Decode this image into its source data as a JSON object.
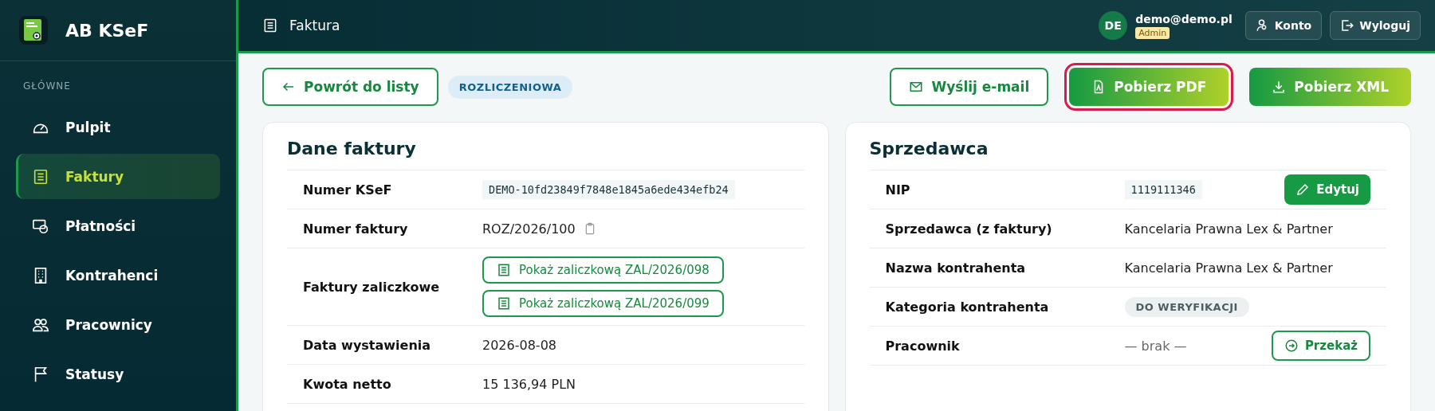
{
  "brand": {
    "name": "AB KSeF"
  },
  "sidebar": {
    "section_label": "GŁÓWNE",
    "items": [
      {
        "label": "Pulpit",
        "selected": false
      },
      {
        "label": "Faktury",
        "selected": true
      },
      {
        "label": "Płatności",
        "selected": false
      },
      {
        "label": "Kontrahenci",
        "selected": false
      },
      {
        "label": "Pracownicy",
        "selected": false
      },
      {
        "label": "Statusy",
        "selected": false
      }
    ]
  },
  "header": {
    "title": "Faktura",
    "user": {
      "initials": "DE",
      "email": "demo@demo.pl",
      "role": "Admin"
    },
    "buttons": [
      "Konto",
      "Wyloguj"
    ]
  },
  "toolbar": {
    "back_button": "Powrót do listy",
    "type_badge": "ROZLICZENIOWA",
    "actions": [
      {
        "label": "Wyślij e-mail",
        "kind": "outline",
        "focused": false
      },
      {
        "label": "Pobierz PDF",
        "kind": "solid",
        "focused": true
      },
      {
        "label": "Pobierz XML",
        "kind": "solid",
        "focused": false
      }
    ]
  },
  "invoice_card": {
    "title": "Dane faktury",
    "rows": [
      {
        "label": "Numer KSeF",
        "kind": "code",
        "value": "DEMO-10fd23849f7848e1845a6ede434efb24"
      },
      {
        "label": "Numer faktury",
        "kind": "copy",
        "value": "ROZ/2026/100"
      },
      {
        "label": "Faktury zaliczkowe",
        "kind": "links",
        "links": [
          "Pokaż zaliczkową ZAL/2026/098",
          "Pokaż zaliczkową ZAL/2026/099"
        ]
      },
      {
        "label": "Data wystawienia",
        "kind": "text",
        "value": "2026-08-08"
      },
      {
        "label": "Kwota netto",
        "kind": "text",
        "value": "15 136,94 PLN"
      }
    ]
  },
  "seller_card": {
    "title": "Sprzedawca",
    "rows": [
      {
        "label": "NIP",
        "kind": "code",
        "value": "1119111346",
        "action": {
          "label": "Edytuj",
          "kind": "solid"
        }
      },
      {
        "label": "Sprzedawca (z faktury)",
        "kind": "text",
        "value": "Kancelaria Prawna Lex & Partner"
      },
      {
        "label": "Nazwa kontrahenta",
        "kind": "text",
        "value": "Kancelaria Prawna Lex & Partner"
      },
      {
        "label": "Kategoria kontrahenta",
        "kind": "badge",
        "value": "DO WERYFIKACJI"
      },
      {
        "label": "Pracownik",
        "kind": "muted",
        "value": "— brak —",
        "action": {
          "label": "Przekaż",
          "kind": "outline"
        }
      }
    ]
  }
}
